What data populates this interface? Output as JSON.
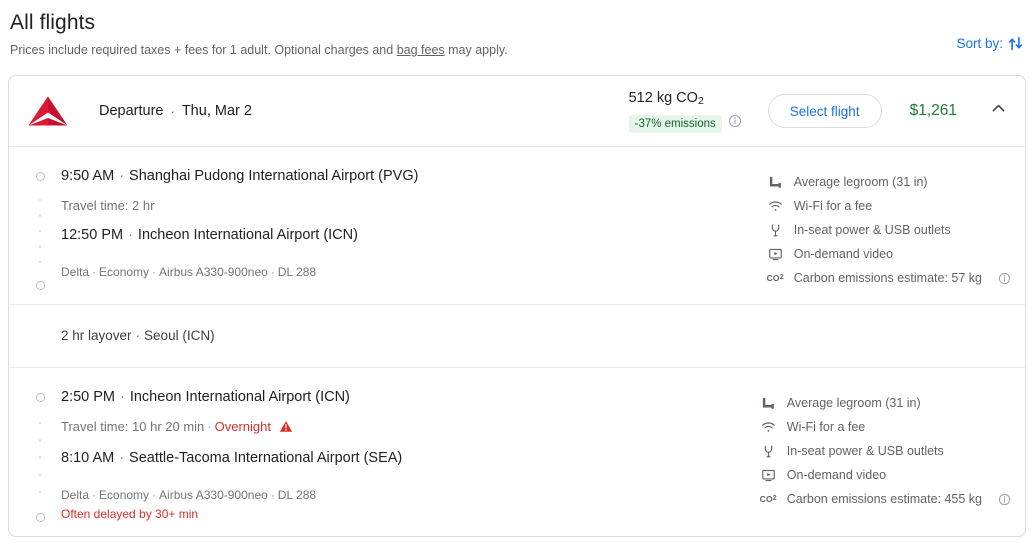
{
  "header": {
    "title": "All flights",
    "subtitle_before": "Prices include required taxes + fees for 1 adult. Optional charges and ",
    "subtitle_link": "bag fees",
    "subtitle_after": " may apply.",
    "sort_label": "Sort by:",
    "sort_icon": "sort-arrows-icon",
    "accent_color": "#1a73e8"
  },
  "card": {
    "airline_logo": "delta-logo-icon",
    "direction_label": "Departure",
    "separator": "·",
    "date": "Thu, Mar 2",
    "emissions": {
      "total": "512 kg CO",
      "subscript": "2",
      "badge": "-37% emissions",
      "badge_bg": "#e6f4ea",
      "badge_color": "#0d652d",
      "info_icon": "info-icon"
    },
    "select_flight_label": "Select flight",
    "price": "$1,261",
    "price_color": "#188038",
    "collapse_icon": "chevron-up-icon",
    "segments": [
      {
        "depart_time": "9:50 AM",
        "depart_airport": "Shanghai Pudong International Airport (PVG)",
        "travel_time_label": "Travel time: 2 hr",
        "overnight": "",
        "arrive_time": "12:50 PM",
        "arrive_airport": "Incheon International Airport (ICN)",
        "meta": [
          "Delta",
          "Economy",
          "Airbus A330-900neo",
          "DL 288"
        ],
        "delay_note": "",
        "amenities": [
          {
            "icon": "legroom-icon",
            "label": "Average legroom (31 in)",
            "info": false
          },
          {
            "icon": "wifi-icon",
            "label": "Wi-Fi for a fee",
            "info": false
          },
          {
            "icon": "power-plug-icon",
            "label": "In-seat power & USB outlets",
            "info": false
          },
          {
            "icon": "on-demand-video-icon",
            "label": "On-demand video",
            "info": false
          },
          {
            "icon": "co2-icon",
            "label": "Carbon emissions estimate: 57 kg",
            "info": true
          }
        ]
      },
      {
        "depart_time": "2:50 PM",
        "depart_airport": "Incheon International Airport (ICN)",
        "travel_time_label": "Travel time: 10 hr 20 min",
        "overnight": "Overnight",
        "arrive_time": "8:10 AM",
        "arrive_airport": "Seattle-Tacoma International Airport (SEA)",
        "meta": [
          "Delta",
          "Economy",
          "Airbus A330-900neo",
          "DL 288"
        ],
        "delay_note": "Often delayed by 30+ min",
        "amenities": [
          {
            "icon": "legroom-icon",
            "label": "Average legroom (31 in)",
            "info": false
          },
          {
            "icon": "wifi-icon",
            "label": "Wi-Fi for a fee",
            "info": false
          },
          {
            "icon": "power-plug-icon",
            "label": "In-seat power & USB outlets",
            "info": false
          },
          {
            "icon": "on-demand-video-icon",
            "label": "On-demand video",
            "info": false
          },
          {
            "icon": "co2-icon",
            "label": "Carbon emissions estimate: 455 kg",
            "info": true
          }
        ]
      }
    ],
    "layover": {
      "duration": "2 hr layover",
      "separator": "·",
      "city": "Seoul (ICN)"
    }
  }
}
